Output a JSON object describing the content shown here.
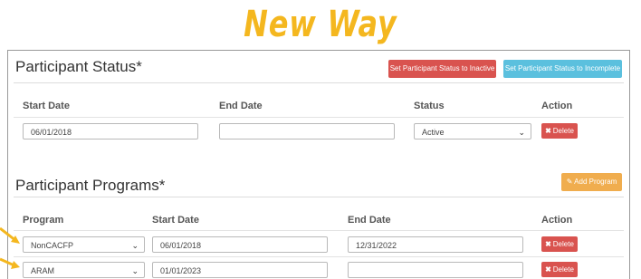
{
  "banner": {
    "text": "New Way"
  },
  "status_section": {
    "title": "Participant Status*",
    "btn_inactive": "Set Participant Status to Inactive",
    "btn_incomplete": "Set Participant Status to Incomplete",
    "headers": {
      "start": "Start Date",
      "end": "End Date",
      "status": "Status",
      "action": "Action"
    },
    "row": {
      "start": "06/01/2018",
      "end": "",
      "status": "Active",
      "delete": "Delete"
    }
  },
  "programs_section": {
    "title": "Participant Programs*",
    "add_button": "Add Program",
    "headers": {
      "program": "Program",
      "start": "Start Date",
      "end": "End Date",
      "action": "Action"
    },
    "rows": [
      {
        "program": "NonCACFP",
        "start": "06/01/2018",
        "end": "12/31/2022",
        "delete": "Delete"
      },
      {
        "program": "ARAM",
        "start": "01/01/2023",
        "end": "",
        "delete": "Delete"
      }
    ]
  },
  "colors": {
    "banner": "#f4b71f",
    "danger": "#d9534f",
    "info": "#5bc0de",
    "warning": "#f0ad4e",
    "arrow": "#f4b71f"
  },
  "icons": [
    "times-icon",
    "edit-icon",
    "chevron-down-icon",
    "arrow-icon"
  ]
}
